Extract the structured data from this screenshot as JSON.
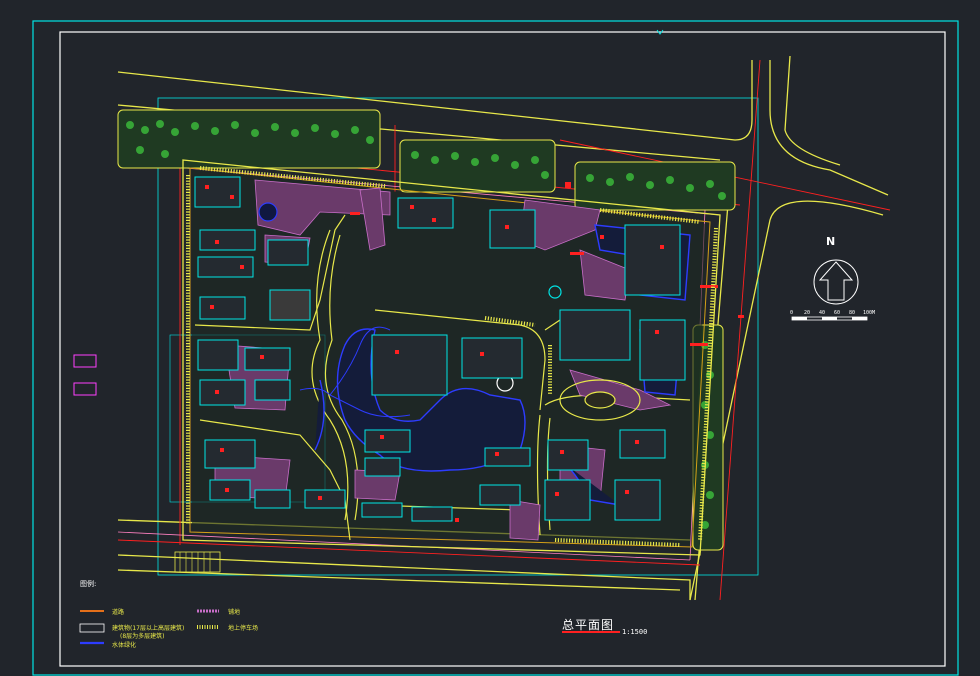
{
  "drawing": {
    "title": "总平面图",
    "scale": "1:1500",
    "north_label": "N",
    "legend_heading": "图例:",
    "scale_bar_ticks": [
      "0",
      "20",
      "40",
      "60",
      "80",
      "100M"
    ],
    "legend_items": [
      {
        "label": "道路",
        "color": "#d4a017"
      },
      {
        "label": "建筑物(17层以上高层建筑)",
        "color": "#ffffff"
      },
      {
        "label": "(8层为多层建筑)",
        "color": "#ffffff"
      },
      {
        "label": "水体绿化",
        "color": "#2d3cff"
      },
      {
        "label": "铺地",
        "color": "#c86ec8"
      },
      {
        "label": "地上停车场",
        "color": "#e8e84a"
      }
    ]
  },
  "colors": {
    "background": "#21252b",
    "frame": "#00e5e5",
    "inner_frame": "#ffffff",
    "road": "#e8e84a",
    "red_line": "#ff2020",
    "building": "#00e5e5",
    "water": "#2d3cff",
    "paving": "#c86ec8",
    "green": "#3cbf3c"
  }
}
